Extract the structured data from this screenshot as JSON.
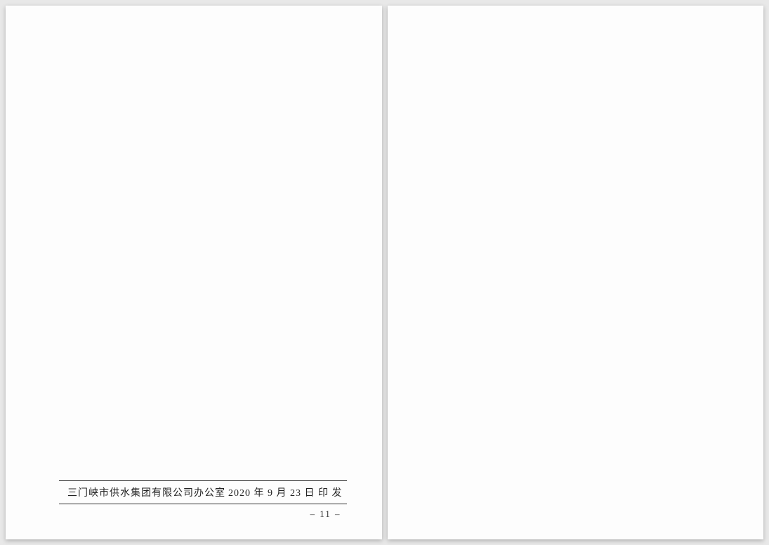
{
  "left_page": {
    "footer": {
      "issuer": "三门峡市供水集团有限公司办公室",
      "date": "2020 年 9 月 23 日 印 发"
    },
    "page_number": "– 11 –"
  }
}
